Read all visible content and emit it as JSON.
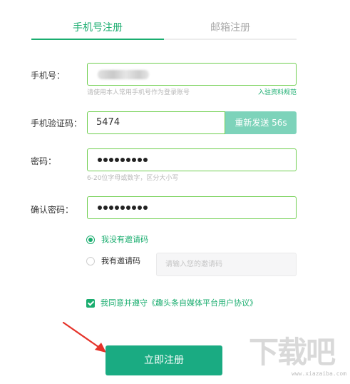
{
  "tabs": [
    {
      "label": "手机号注册",
      "active": true
    },
    {
      "label": "邮箱注册",
      "active": false
    }
  ],
  "phone": {
    "label": "手机号：",
    "hint": "请使用本人常用手机号作为登录账号",
    "link": "入驻资料规范"
  },
  "code": {
    "label": "手机验证码：",
    "value": "5474",
    "resend": "重新发送 56s"
  },
  "password": {
    "label": "密码：",
    "dot_count": 9,
    "hint": "6-20位字母或数字，区分大小写"
  },
  "confirm": {
    "label": "确认密码：",
    "dot_count": 9
  },
  "invite": {
    "option_none": "我没有邀请码",
    "option_have": "我有邀请码",
    "placeholder": "请输入您的邀请码",
    "selected": "none"
  },
  "agreement": {
    "text": "我同意并遵守",
    "link": "《趣头条自媒体平台用户协议》",
    "checked": true
  },
  "submit": {
    "label": "立即注册"
  },
  "watermark": {
    "text": "下载吧",
    "url": "www.xiazaiba.com"
  },
  "colors": {
    "accent": "#1aad6f",
    "input_border": "#6fcf4f",
    "resend_bg": "#7dd3ba",
    "button_bg": "#1aab82",
    "arrow": "#e5332a"
  }
}
